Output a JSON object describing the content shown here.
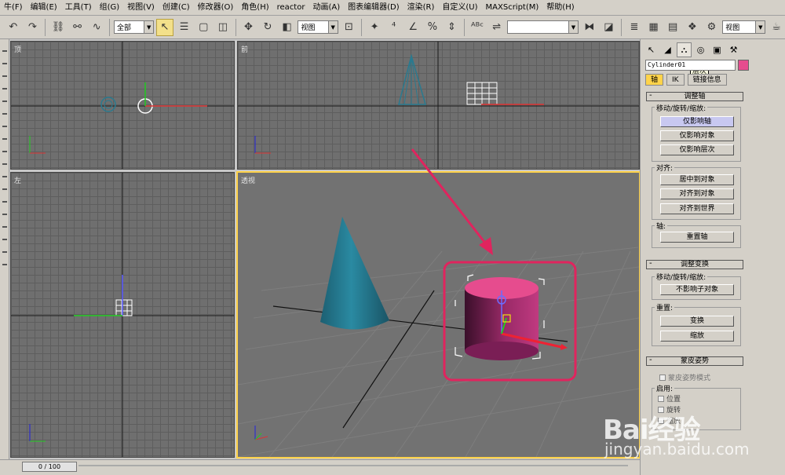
{
  "menu": [
    "牛(F)",
    "编辑(E)",
    "工具(T)",
    "组(G)",
    "视图(V)",
    "创建(C)",
    "修改器(O)",
    "角色(H)",
    "reactor",
    "动画(A)",
    "图表编辑器(D)",
    "渲染(R)",
    "自定义(U)",
    "MAXScript(M)",
    "帮助(H)"
  ],
  "toolbar": {
    "selection_filter": "全部",
    "ref_coord": "视图",
    "named_sel_placeholder": "",
    "right_combo": "视图"
  },
  "viewports": {
    "top": "顶",
    "front": "前",
    "left": "左",
    "perspective": "透视"
  },
  "panel": {
    "tooltip": "层次",
    "object_name": "Cylinder01",
    "color": "#e64c8e",
    "subtabs": [
      "轴",
      "IK",
      "链接信息"
    ],
    "adjust_pivot": {
      "title": "调整轴",
      "move_group": "移动/旋转/缩放:",
      "affect_pivot": "仅影响轴",
      "affect_object": "仅影响对象",
      "affect_hierarchy": "仅影响层次",
      "align_group": "对齐:",
      "center_to_object": "居中到对象",
      "align_to_object": "对齐到对象",
      "align_to_world": "对齐到世界",
      "pivot_group": "轴:",
      "reset_pivot": "重置轴"
    },
    "adjust_transform": {
      "title": "调整变换",
      "move_group": "移动/旋转/缩放:",
      "dont_affect_children": "不影响子对象",
      "reset_group": "重置:",
      "transform": "变换",
      "scale": "缩放"
    },
    "skin_pose": {
      "title": "蒙皮姿势",
      "skin_pose_mode": "蒙皮姿势模式",
      "enable_group": "启用:",
      "position": "位置",
      "rotation": "旋转",
      "scale": "缩放"
    }
  },
  "timeline": {
    "slider": "0 / 100"
  },
  "watermark": {
    "brand": "Bai经验",
    "url": "jingyan.baidu.com"
  },
  "colors": {
    "active_viewport": "#ffd34a",
    "highlight": "#e0245e",
    "object": "#e64c8e",
    "cone": "#2a7a8f"
  }
}
